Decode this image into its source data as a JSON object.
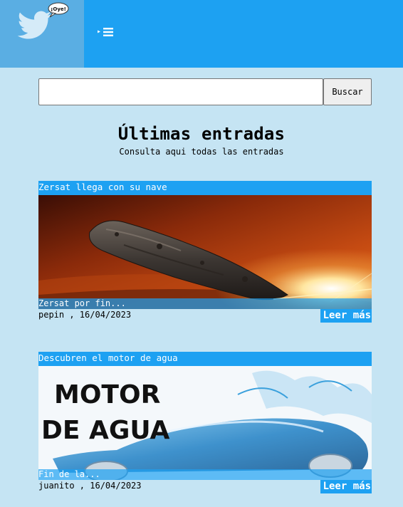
{
  "header": {
    "menu_icon": "hamburger-icon",
    "logo_icon": "twitter-bird-icon",
    "logo_bubble_text": "¡Oye!"
  },
  "search": {
    "value": "",
    "placeholder": "",
    "button_label": "Buscar"
  },
  "main": {
    "title": "Últimas entradas",
    "subtitle": "Consulta aqui todas las entradas"
  },
  "posts": [
    {
      "title": "Zersat llega con su nave",
      "excerpt": "Zersat por fin...",
      "meta": "pepin , 16/04/2023",
      "read_more": "Leer más",
      "image": "asteroid-image"
    },
    {
      "title": "Descubren el motor de agua",
      "excerpt": "Fin de la...",
      "meta": "juanito , 16/04/2023",
      "read_more": "Leer más",
      "image": "water-car-image",
      "image_text_line1": "MOTOR",
      "image_text_line2": "DE AGUA"
    }
  ],
  "colors": {
    "page_bg": "#c5e4f3",
    "header_bg": "#1da1f2",
    "logo_bg": "#5aaee3",
    "accent": "#1da1f2"
  }
}
